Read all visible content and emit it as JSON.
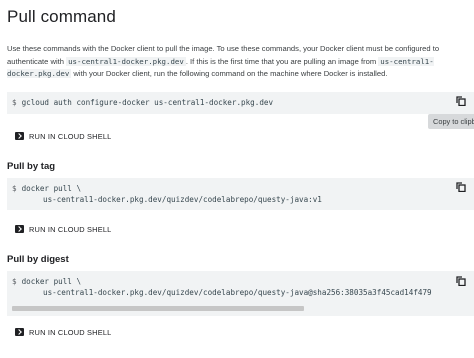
{
  "title": "Pull command",
  "intro": {
    "p1": "Use these commands with the Docker client to pull the image. To use these commands, your Docker client must be configured to authenticate with ",
    "code1": "us-central1-docker.pkg.dev",
    "p2": ". If this is the first time that you are pulling an image from ",
    "code2": "us-central1-docker.pkg.dev",
    "p3": " with your Docker client, run the following command on the machine where Docker is installed."
  },
  "prompt": "$",
  "auth_block": {
    "command": "gcloud auth configure-docker us-central1-docker.pkg.dev",
    "copy_tooltip": "Copy to clipb"
  },
  "cloud_shell_label": "RUN IN CLOUD SHELL",
  "pull_by_tag": {
    "heading": "Pull by tag",
    "line1": "docker pull \\",
    "line2": "us-central1-docker.pkg.dev/quizdev/codelabrepo/questy-java:v1"
  },
  "pull_by_digest": {
    "heading": "Pull by digest",
    "line1": "docker pull \\",
    "line2": "us-central1-docker.pkg.dev/quizdev/codelabrepo/questy-java@sha256:38035a3f45cad14f479"
  },
  "icons": {
    "copy": "copy-icon",
    "cloud_shell": "terminal-icon"
  }
}
